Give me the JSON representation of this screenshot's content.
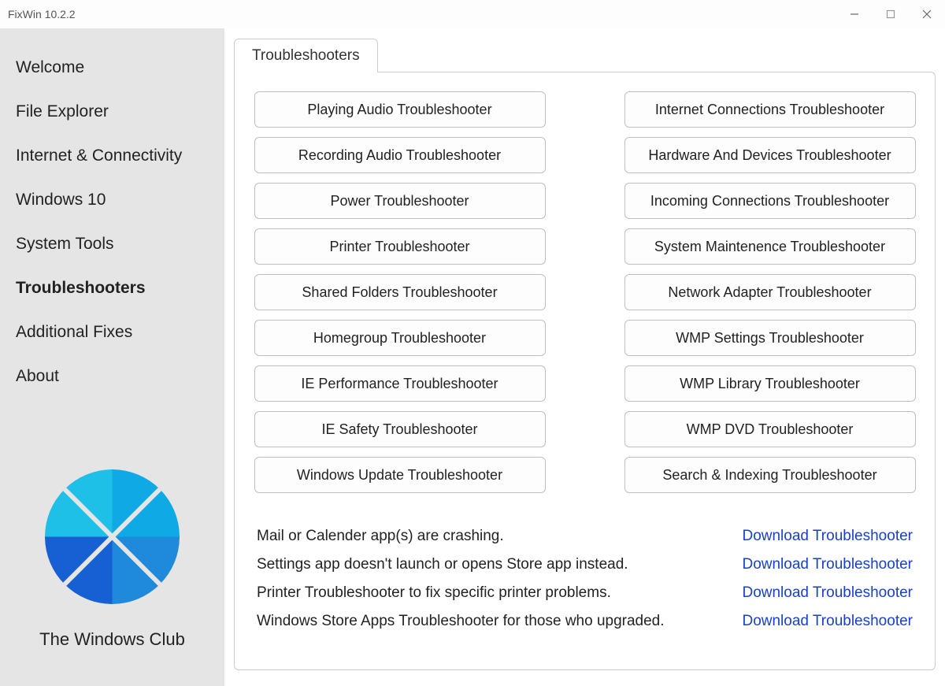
{
  "window": {
    "title": "FixWin 10.2.2"
  },
  "sidebar": {
    "items": [
      {
        "label": "Welcome",
        "active": false
      },
      {
        "label": "File Explorer",
        "active": false
      },
      {
        "label": "Internet & Connectivity",
        "active": false
      },
      {
        "label": "Windows 10",
        "active": false
      },
      {
        "label": "System Tools",
        "active": false
      },
      {
        "label": "Troubleshooters",
        "active": true
      },
      {
        "label": "Additional Fixes",
        "active": false
      },
      {
        "label": "About",
        "active": false
      }
    ],
    "brand": "The Windows Club"
  },
  "tab": {
    "label": "Troubleshooters"
  },
  "troubleshooters_left": [
    "Playing Audio Troubleshooter",
    "Recording Audio Troubleshooter",
    "Power Troubleshooter",
    "Printer Troubleshooter",
    "Shared Folders Troubleshooter",
    "Homegroup Troubleshooter",
    "IE Performance Troubleshooter",
    "IE Safety Troubleshooter",
    "Windows Update Troubleshooter"
  ],
  "troubleshooters_right": [
    "Internet Connections Troubleshooter",
    "Hardware And Devices Troubleshooter",
    "Incoming Connections Troubleshooter",
    "System Maintenence Troubleshooter",
    "Network Adapter Troubleshooter",
    "WMP Settings Troubleshooter",
    "WMP Library Troubleshooter",
    "WMP DVD Troubleshooter",
    "Search & Indexing Troubleshooter"
  ],
  "download_rows": [
    {
      "text": "Mail or Calender app(s) are crashing.",
      "link": "Download Troubleshooter"
    },
    {
      "text": "Settings app doesn't launch or opens Store app instead.",
      "link": "Download Troubleshooter"
    },
    {
      "text": "Printer Troubleshooter to fix specific printer problems.",
      "link": "Download Troubleshooter"
    },
    {
      "text": "Windows Store Apps Troubleshooter for those who upgraded.",
      "link": "Download Troubleshooter"
    }
  ]
}
